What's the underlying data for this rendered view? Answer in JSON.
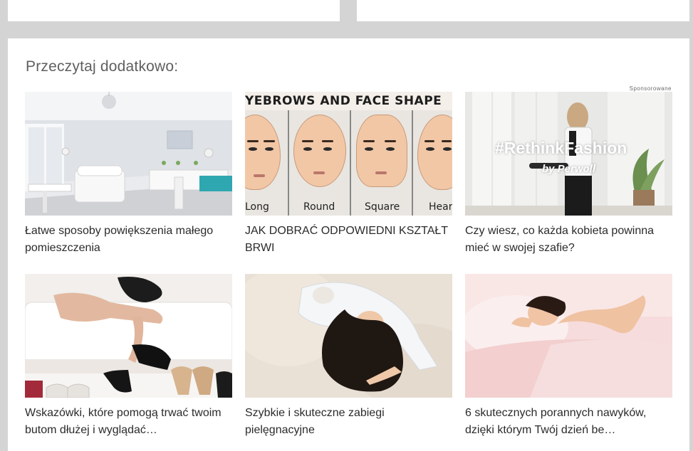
{
  "section": {
    "title": "Przeczytaj dodatkowo:",
    "sponsored_label": "Sponsorowane"
  },
  "articles": [
    {
      "title": "Łatwe sposoby powiększenia małego pomieszczenia"
    },
    {
      "title": "JAK DOBRAĆ ODPOWIEDNI KSZTAŁT BRWI",
      "image_text": {
        "heading": "YEBROWS AND FACE SHAPE",
        "labels": [
          "Long",
          "Round",
          "Square",
          "Hear"
        ]
      }
    },
    {
      "title": "Czy wiesz, co każda kobieta powinna mieć w swojej szafie?",
      "image_text": {
        "hashtag": "#RethinkFashion",
        "brand": "by Perwoll"
      }
    },
    {
      "title": "Wskazówki, które pomogą trwać twoim butom dłużej i wyglądać…"
    },
    {
      "title": "Szybkie i skuteczne zabiegi pielęgnacyjne"
    },
    {
      "title": "6 skutecznych porannych nawyków, dzięki którym Twój dzień be…"
    }
  ]
}
